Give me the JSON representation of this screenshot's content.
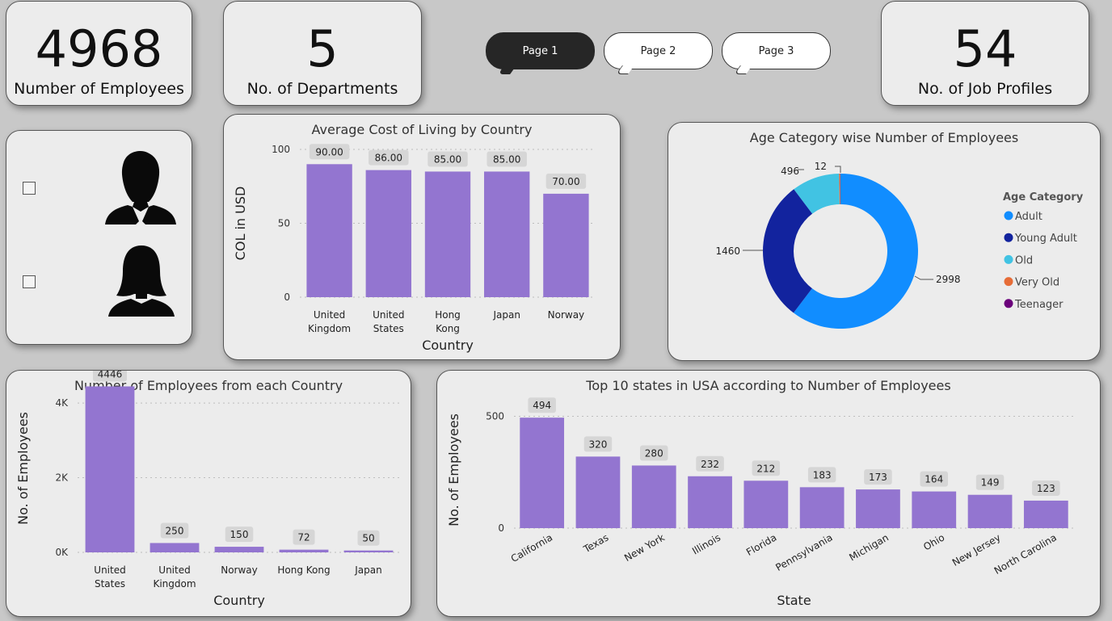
{
  "kpis": {
    "employees": {
      "value": "4968",
      "label": "Number of Employees"
    },
    "departments": {
      "value": "5",
      "label": "No. of Departments"
    },
    "job_profiles": {
      "value": "54",
      "label": "No. of Job Profiles"
    }
  },
  "pages": [
    {
      "label": "Page 1",
      "active": true
    },
    {
      "label": "Page 2",
      "active": false
    },
    {
      "label": "Page 3",
      "active": false
    }
  ],
  "gender_filter": {
    "items": [
      "male-avatar-icon",
      "female-avatar-icon"
    ]
  },
  "colors": {
    "bar": "#9375d0",
    "adult": "#118dff",
    "young_adult": "#12239e",
    "old": "#41c3e3",
    "very_old": "#e66c37",
    "teenager": "#6b007b"
  },
  "chart_data": [
    {
      "id": "cost_of_living",
      "type": "bar",
      "title": "Average Cost of Living by Country",
      "xlabel": "Country",
      "ylabel": "COL in USD",
      "categories": [
        "United Kingdom",
        "United States",
        "Hong Kong",
        "Japan",
        "Norway"
      ],
      "category_lines": [
        [
          "United",
          "Kingdom"
        ],
        [
          "United",
          "States"
        ],
        [
          "Hong",
          "Kong"
        ],
        [
          "Japan"
        ],
        [
          "Norway"
        ]
      ],
      "values": [
        90,
        86,
        85,
        85,
        70
      ],
      "data_labels": [
        "90.00",
        "86.00",
        "85.00",
        "85.00",
        "70.00"
      ],
      "yticks": [
        "0",
        "50",
        "100"
      ],
      "ylim": [
        0,
        100
      ],
      "grid": true
    },
    {
      "id": "age_category",
      "type": "pie",
      "title": "Age Category wise Number of Employees",
      "legend_title": "Age Category",
      "legend_position": "right",
      "labels": [
        "Adult",
        "Young Adult",
        "Old",
        "Very Old",
        "Teenager"
      ],
      "values": [
        2998,
        1460,
        496,
        12,
        2
      ],
      "data_labels": [
        "2998",
        "1460",
        "496",
        "12",
        ""
      ]
    },
    {
      "id": "employees_by_country",
      "type": "bar",
      "title": "Number of Employees from each Country",
      "xlabel": "Country",
      "ylabel": "No. of Employees",
      "categories": [
        "United States",
        "United Kingdom",
        "Norway",
        "Hong Kong",
        "Japan"
      ],
      "category_lines": [
        [
          "United",
          "States"
        ],
        [
          "United",
          "Kingdom"
        ],
        [
          "Norway"
        ],
        [
          "Hong Kong"
        ],
        [
          "Japan"
        ]
      ],
      "values": [
        4446,
        250,
        150,
        72,
        50
      ],
      "data_labels": [
        "4446",
        "250",
        "150",
        "72",
        "50"
      ],
      "yticks": [
        "0K",
        "2K",
        "4K"
      ],
      "ylim": [
        0,
        4500
      ],
      "grid": true
    },
    {
      "id": "top_states",
      "type": "bar",
      "title": "Top 10 states in USA according to Number of Employees",
      "xlabel": "State",
      "ylabel": "No. of Employees",
      "categories": [
        "California",
        "Texas",
        "New York",
        "Illinois",
        "Florida",
        "Pennsylvania",
        "Michigan",
        "Ohio",
        "New Jersey",
        "North Carolina"
      ],
      "values": [
        494,
        320,
        280,
        232,
        212,
        183,
        173,
        164,
        149,
        123
      ],
      "data_labels": [
        "494",
        "320",
        "280",
        "232",
        "212",
        "183",
        "173",
        "164",
        "149",
        "123"
      ],
      "yticks": [
        "0",
        "500"
      ],
      "ylim": [
        0,
        520
      ],
      "grid": true
    }
  ]
}
